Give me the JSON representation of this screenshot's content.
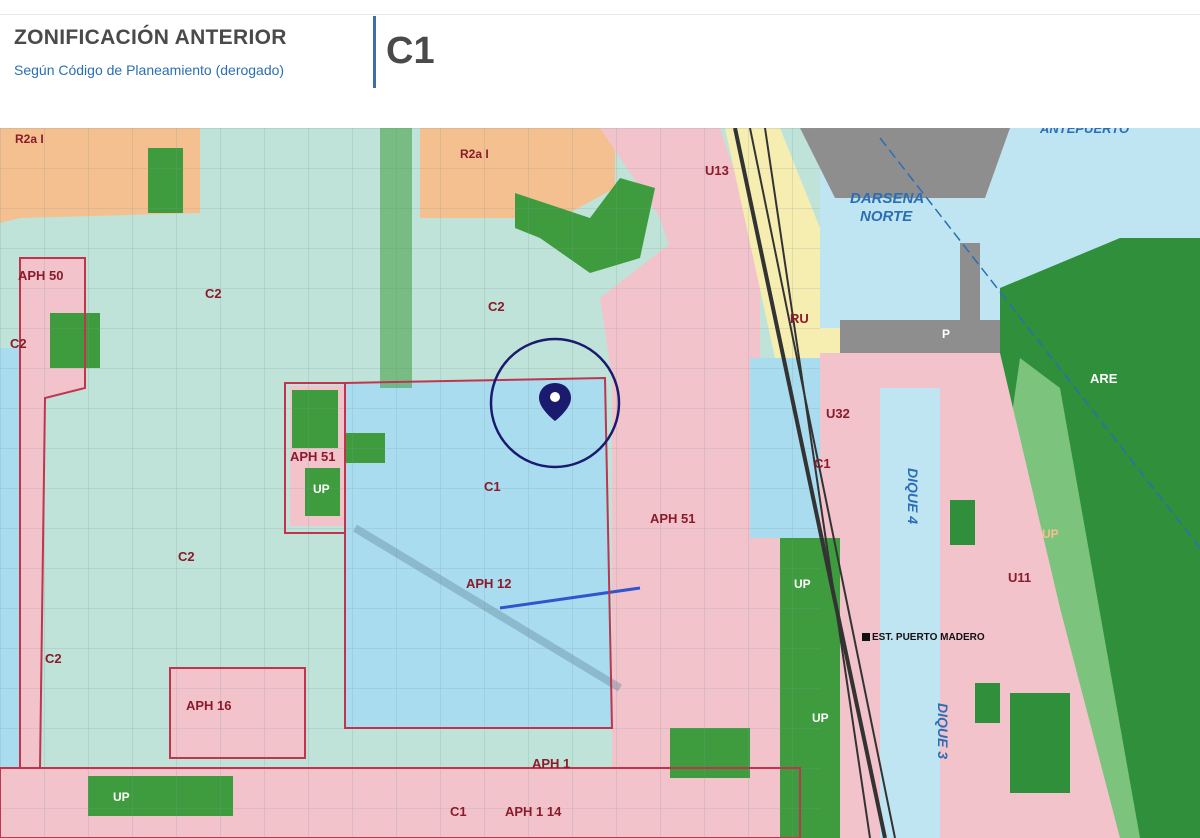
{
  "header": {
    "title": "ZONIFICACIÓN ANTERIOR",
    "subtitle": "Según Código de Planeamiento (derogado)",
    "zone_code": "C1"
  },
  "map": {
    "colors": {
      "c2_zone": "#bfe3d8",
      "c1_zone": "#a9dcef",
      "aph_zone": "#f3c3cc",
      "r2a_zone": "#f5c08f",
      "up_green": "#3e9b3e",
      "water": "#bfe5f3",
      "port_gray": "#8e8e8e",
      "ru_yellow": "#f6edb0",
      "reserve_green": "#2f8f3a",
      "pin": "#1a1a6e"
    },
    "zone_labels": {
      "r2a_left": "R2a I",
      "r2a_right": "R2a I",
      "aph50": "APH 50",
      "c2_top": "C2",
      "c2_mid": "C2",
      "c2_left": "C2",
      "c2_center": "C2",
      "c2_bottom": "C2",
      "aph51_left": "APH 51",
      "up_left": "UP",
      "c1_center": "C1",
      "aph12": "APH 12",
      "aph16": "APH 16",
      "aph1": "APH 1",
      "c1_bottom": "C1",
      "aph1_14": "APH 1 14",
      "up_bottom": "UP",
      "aph51_right": "APH 51",
      "c1_right": "C1",
      "u13": "U13",
      "ru": "RU",
      "u32": "U32",
      "up_east1": "UP",
      "up_east2": "UP",
      "dique4": "DIQUE 4",
      "dique3": "DIQUE 3",
      "u11": "U11",
      "up_far": "UP",
      "are": "ARE",
      "p": "P",
      "darsena": "DARSENA",
      "norte": "NORTE",
      "antepuerto": "ANTEPUERTO",
      "estacion": "EST. PUERTO MADERO"
    }
  }
}
